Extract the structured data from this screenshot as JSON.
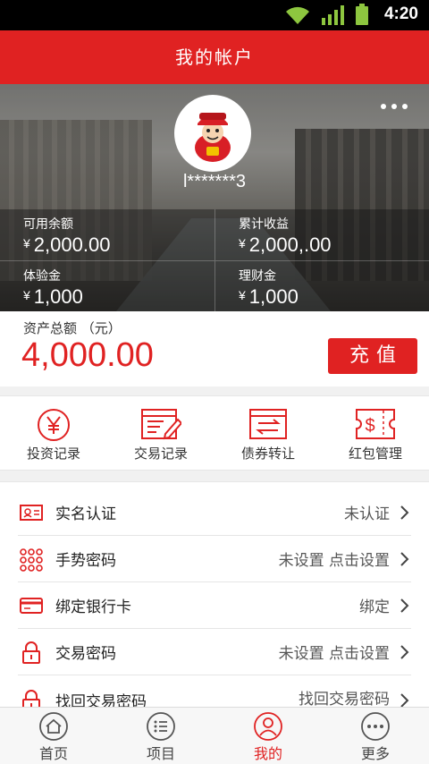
{
  "status_bar": {
    "time": "4:20",
    "icons": [
      "wifi-icon",
      "signal-icon",
      "battery-icon"
    ]
  },
  "header": {
    "title": "我的帐户"
  },
  "profile": {
    "username": "l*******3",
    "more_icon": "more-icon"
  },
  "stats": [
    {
      "label": "可用余额",
      "currency": "¥",
      "value": "2,000.00"
    },
    {
      "label": "累计收益",
      "currency": "¥",
      "value": "2,000,.00"
    },
    {
      "label": "体验金",
      "currency": "¥",
      "value": "1,000"
    },
    {
      "label": "理财金",
      "currency": "¥",
      "value": "1,000"
    }
  ],
  "total": {
    "label": "资产总额 （元）",
    "amount": "4,000.00",
    "recharge_label": "充值"
  },
  "quick_actions": [
    {
      "label": "投资记录",
      "icon": "yen-circle-icon"
    },
    {
      "label": "交易记录",
      "icon": "document-edit-icon"
    },
    {
      "label": "债券转让",
      "icon": "transfer-icon"
    },
    {
      "label": "红包管理",
      "icon": "red-packet-icon"
    }
  ],
  "settings": [
    {
      "label": "实名认证",
      "status": "未认证",
      "icon": "id-card-icon"
    },
    {
      "label": "手势密码",
      "status": "未设置 点击设置",
      "icon": "gesture-grid-icon"
    },
    {
      "label": "绑定银行卡",
      "status": "绑定",
      "icon": "bank-card-icon"
    },
    {
      "label": "交易密码",
      "status": "未设置 点击设置",
      "icon": "lock-icon"
    },
    {
      "label": "找回交易密码",
      "status": "找回交易密码",
      "icon": "lock-icon"
    }
  ],
  "tabs": [
    {
      "label": "首页",
      "icon": "home-icon",
      "active": false
    },
    {
      "label": "项目",
      "icon": "list-icon",
      "active": false
    },
    {
      "label": "我的",
      "icon": "user-icon",
      "active": true
    },
    {
      "label": "更多",
      "icon": "more-circle-icon",
      "active": false
    }
  ],
  "colors": {
    "accent": "#e02222",
    "background": "#f1f1f1"
  }
}
